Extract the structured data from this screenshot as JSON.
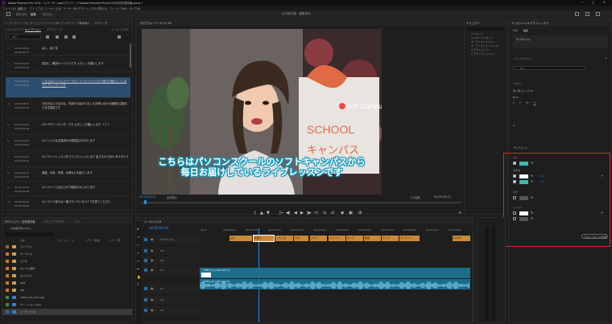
{
  "window": {
    "title": "Adobe Premiere Pro 2024 - C:\\ユーザー\\user\\デスクトップ\\Adobe Premiere Pro\\2024\\月中日本語字幕.prproj *",
    "controls": [
      "─",
      "□",
      "✕"
    ]
  },
  "menu": [
    "ファイル(F)",
    "編集(E)",
    "クリップ(C)",
    "シーケンス(S)",
    "マーカー(M)",
    "グラフィック(G)",
    "表示(V)",
    "ウィンドウ(W)",
    "ヘルプ(H)"
  ],
  "workspace": {
    "tabs": [
      "読み込み",
      "編集",
      "書き出し"
    ],
    "title": "日本語字幕 - 編集済み"
  },
  "captions_panel": {
    "tabs": [
      "ソース: (クリップなし)",
      "エフェクトコントロール",
      "オーディオクリップミキサー",
      "テキスト",
      "メタデータ",
      "トランスクリプト",
      "キャプション",
      "グラフィック",
      "シーケンス 01"
    ],
    "search_placeholder": "検索",
    "rows": [
      {
        "num": "1",
        "tc_in": "00;00;00;00",
        "tc_out": "00;00;00;17",
        "text": "はい、皆さま"
      },
      {
        "num": "2",
        "tc_in": "00;00;00;24",
        "tc_out": "00;00;03;12",
        "text": "初回と、解説キャンパスです よろしくお願いします"
      },
      {
        "num": "3",
        "tc_in": "00;00;03;21",
        "tc_out": "00;00;08;06",
        "text": "こちらはパソコンスクールのソフトキャンパスから毎日お届けしているライブレッスンです"
      },
      {
        "num": "4",
        "tc_in": "00;00;08;15",
        "tc_out": "00;00;12;09",
        "text": "今日お伝えするのは、先週から始まりましたお問い合わせ連絡を生配信する生放送です"
      },
      {
        "num": "5",
        "tc_in": "00;00;13;00",
        "tc_out": "00;00;15;18",
        "text": "ロケデザインセンターです よろしくお願いします ソフト"
      },
      {
        "num": "6",
        "tc_in": "00;00;16;24",
        "tc_out": "00;00;19;07",
        "text": "キャンパスは生放送中の受講生の方がいます"
      },
      {
        "num": "7",
        "tc_in": "00;00;19;12",
        "tc_out": "00;00;24;11",
        "text": "オンラインレッスンをでていらっしゃいます 皆さまから色々 ありがとう"
      },
      {
        "num": "8",
        "tc_in": "00;00;24;12",
        "tc_out": "00;00;29;05",
        "text": "講座、仕事、作業、仕様などを紹介します"
      },
      {
        "num": "9",
        "tc_in": "00;00;29;21",
        "tc_out": "00;00;31;00",
        "text": "オンラインでは仕上がり配信のみになります"
      },
      {
        "num": "10",
        "tc_in": "00;00;31;21",
        "tc_out": "00;00;35;00",
        "text": "オンライン版では一番で行っているライブを見てください"
      }
    ]
  },
  "program_monitor": {
    "tab": "プログラム: シーケンス 01",
    "subtitle_line1": "こちらはパソコンスクールのソフトキャンパスから",
    "subtitle_line2": "毎日お届けしているライブレッスンです",
    "sign_brand": "Soft Campus",
    "sign_school": "SCHOOL",
    "sign_kana": "キャンパス",
    "timecode_left": "00;00;04;04",
    "fit": "全体表示",
    "quality": "フル画質",
    "timecode_right": "00;00;50;23",
    "transport": [
      "{",
      "▲",
      "▼",
      "|←",
      "◀|",
      "◀",
      "▶",
      "|▶",
      "→|",
      "⇆",
      "⇄",
      "◉",
      "▣",
      "⊞",
      "+"
    ]
  },
  "effects_panel": {
    "tab": "エフェクト",
    "items": [
      "プリセット",
      "Lumetri プリセット",
      "オーディオエフェクト",
      "オーディオトランジション",
      "ビデオエフェクト",
      "ビデオトランジション"
    ]
  },
  "essential_graphics": {
    "tab": "エッセンシャルグラフィックス",
    "sub_tabs": [
      "参照",
      "編集"
    ],
    "track_label": "サブタイトル",
    "track_style": "トラックスタイル",
    "style_value": "なし",
    "align_label": "テキスト",
    "font": "源ノ角ゴシック JP",
    "font_style": "Bold",
    "appearance_label": "アピアランス",
    "fill_label": "塗り",
    "stroke_label": "境界線",
    "background_label": "背景",
    "shadow_label": "シャドウ",
    "stroke_value1": "1.0",
    "stroke_value2": "1.0",
    "button": "テキストスタイルを作成",
    "colors": {
      "fill": "#3fb8ae",
      "stroke1": "#ffffff",
      "stroke2": "#3fb8ae",
      "bg": "#555555",
      "shadow1": "#ffffff",
      "shadow2": "#555555"
    }
  },
  "project_panel": {
    "tabs": [
      "プロジェクト: 日本語字幕",
      "メディアブラウザー",
      "ライ"
    ],
    "path": "日本語字幕.prproj",
    "columns": [
      "名前",
      "フレームレート",
      "メディア開始",
      "メディア終"
    ],
    "items": [
      "ライブラリ",
      "オーディオ",
      "ビデオ",
      "タイトル素材",
      "オリジナル",
      "MP4",
      "SRT",
      "VIDEO_02_LIVE.mp4",
      "ナレーション.mp3",
      "シーケンス 01"
    ]
  },
  "timeline": {
    "tab": "シーケンス 01",
    "timecode": "00;00;04;04",
    "ruler": [
      "00;00",
      "00;00;04;00",
      "00;00;08;00",
      "00;00;12;00",
      "00;00;16;00",
      "00;00;20;00",
      "00;00;24;00",
      "00;00;28;00",
      "00;00;32;00",
      "00;00;36;00",
      "00;00;40;00",
      "00;00;44;00"
    ],
    "tracks": [
      "サブタイトル",
      "V3",
      "V2",
      "V1",
      "A1",
      "A2",
      "A3"
    ],
    "caption_clips": [
      "はい、",
      "初回と、",
      "こちらは",
      "今日",
      "ロケデ",
      "キャンパ",
      "オンラ",
      "講座、",
      "オンラ",
      "オンライン",
      "ELLIST"
    ],
    "video_clip": "VIDEO_02_LIVE.mp4 [V]",
    "audio_clip": "VIDEO_02_LIVE.mp4 [A]"
  },
  "highlight_color": "#e0232b"
}
